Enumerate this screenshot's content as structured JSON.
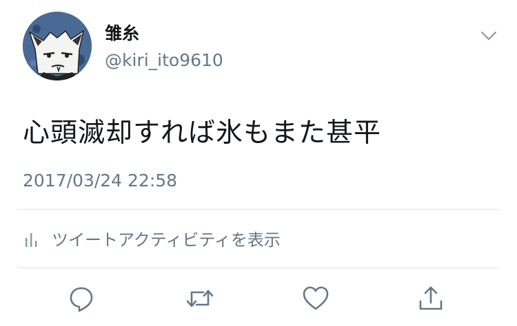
{
  "user": {
    "display_name": "雏糸",
    "handle": "@kiri_ito9610",
    "avatar_icon": "cartoon-wolf-avatar"
  },
  "tweet": {
    "text": "心頭滅却すれば氷もまた甚平",
    "timestamp": "2017/03/24 22:58"
  },
  "activity": {
    "label": "ツイートアクティビティを表示",
    "icon": "bar-chart-icon"
  },
  "actions": [
    {
      "name": "reply",
      "icon": "speech-bubble-icon"
    },
    {
      "name": "retweet",
      "icon": "retweet-arrows-icon"
    },
    {
      "name": "like",
      "icon": "heart-icon"
    },
    {
      "name": "share",
      "icon": "upload-arrow-icon"
    }
  ],
  "colors": {
    "primary_text": "#14171a",
    "secondary_text": "#657786",
    "divider": "#dfe3e7",
    "icon": "#657786"
  }
}
